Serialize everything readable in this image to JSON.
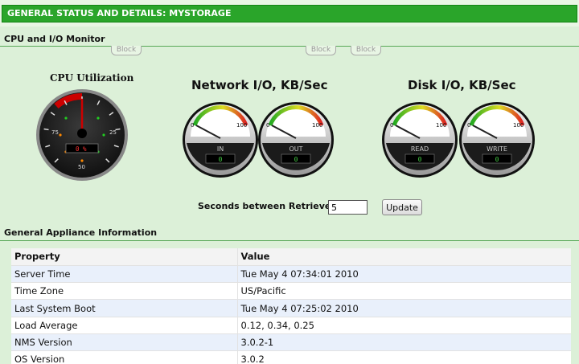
{
  "header": {
    "title": "GENERAL STATUS AND DETAILS: MYSTORAGE"
  },
  "cpu_section": {
    "title": "CPU and I/O Monitor"
  },
  "block_tabs": [
    "Block",
    "Block",
    "Block"
  ],
  "cpu_gauge": {
    "title": "CPU Utilization",
    "value": 0,
    "readout": "0 %",
    "scale_labels": [
      "75",
      "25",
      "50"
    ]
  },
  "network": {
    "title": "Network I/O, KB/Sec",
    "gauges": [
      {
        "label": "IN",
        "value": "0",
        "min": "0",
        "max": "100"
      },
      {
        "label": "OUT",
        "value": "0",
        "min": "0",
        "max": "100"
      }
    ]
  },
  "disk": {
    "title": "Disk I/O, KB/Sec",
    "gauges": [
      {
        "label": "READ",
        "value": "0",
        "min": "0",
        "max": "100"
      },
      {
        "label": "WRITE",
        "value": "0",
        "min": "0",
        "max": "100"
      }
    ]
  },
  "retrieve": {
    "label": "Seconds between Retrieves",
    "value": "5",
    "button": "Update"
  },
  "appliance": {
    "title": "General Appliance Information",
    "columns": [
      "Property",
      "Value"
    ],
    "rows": [
      [
        "Server Time",
        "Tue May 4 07:34:01 2010"
      ],
      [
        "Time Zone",
        "US/Pacific"
      ],
      [
        "Last System Boot",
        "Tue May 4 07:25:02 2010"
      ],
      [
        "Load Average",
        "0.12, 0.34, 0.25"
      ],
      [
        "NMS Version",
        "3.0.2-1"
      ],
      [
        "OS Version",
        "3.0.2"
      ]
    ]
  }
}
